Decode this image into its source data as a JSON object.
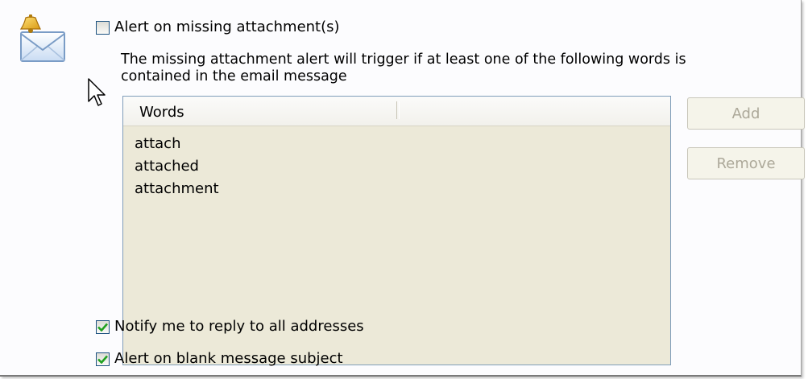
{
  "missing_attachment": {
    "checkbox_label": "Alert on missing attachment(s)",
    "checked": false,
    "description": "The missing attachment alert will trigger if at least one of the following words is contained in the email message",
    "words_list": {
      "column_header": "Words",
      "items": [
        "attach",
        "attached",
        "attachment"
      ]
    },
    "add_button": "Add",
    "remove_button": "Remove"
  },
  "notify_reply_all": {
    "checkbox_label": "Notify me to reply to all addresses",
    "checked": true
  },
  "blank_subject": {
    "checkbox_label": "Alert on blank message subject",
    "checked": true
  },
  "colors": {
    "checkbox_border": "#1c5180",
    "checkmark": "#21a121",
    "list_background": "#ece9d8",
    "disabled_text": "#aca899"
  }
}
